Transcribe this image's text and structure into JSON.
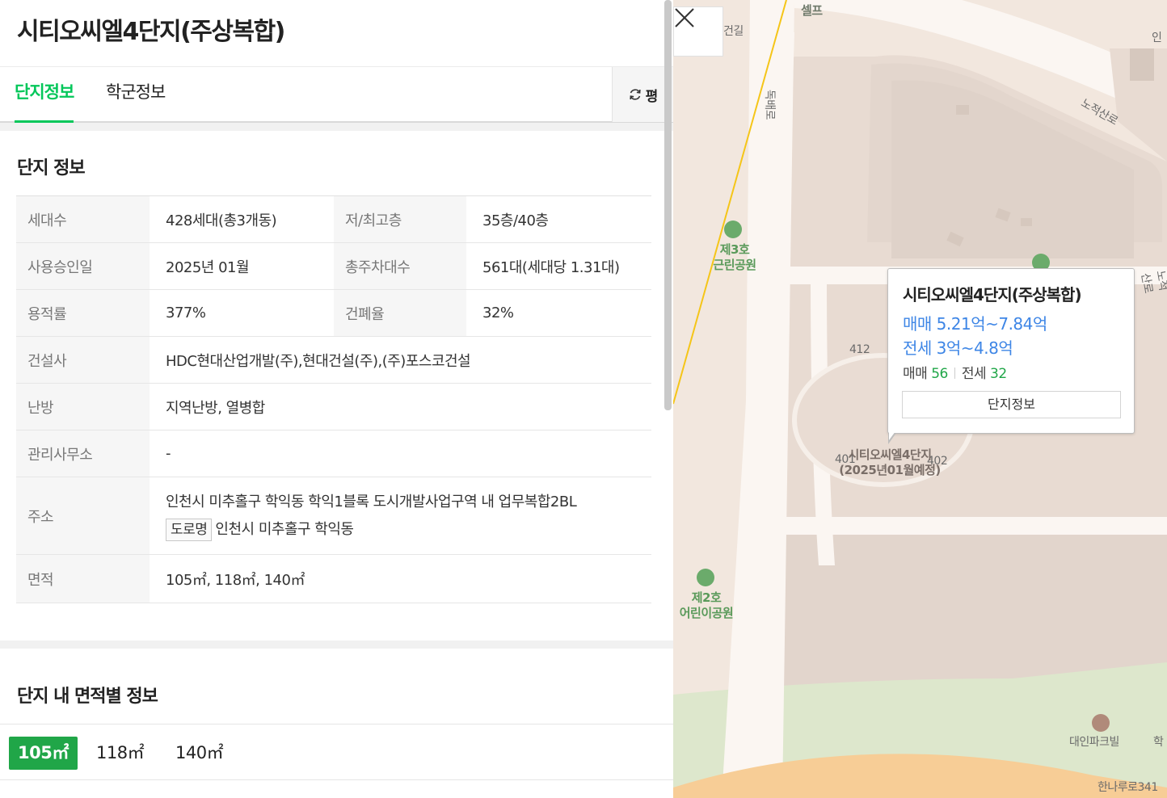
{
  "panel": {
    "title": "시티오씨엘4단지(주상복합)",
    "tabs": [
      "단지정보",
      "학군정보"
    ],
    "unit_toggle_label": "평"
  },
  "info": {
    "heading": "단지 정보",
    "rows": {
      "households_label": "세대수",
      "households_value": "428세대(총3개동)",
      "floors_label": "저/최고층",
      "floors_value": "35층/40층",
      "approval_label": "사용승인일",
      "approval_value": "2025년 01월",
      "parking_label": "총주차대수",
      "parking_value": "561대(세대당 1.31대)",
      "far_label": "용적률",
      "far_value": "377%",
      "bcr_label": "건폐율",
      "bcr_value": "32%",
      "builder_label": "건설사",
      "builder_value": "HDC현대산업개발(주),현대건설(주),(주)포스코건설",
      "heating_label": "난방",
      "heating_value": "지역난방, 열병합",
      "office_label": "관리사무소",
      "office_value": "-",
      "address_label": "주소",
      "address_value": "인천시 미추홀구 학익동 학익1블록 도시개발사업구역 내 업무복합2BL",
      "road_badge": "도로명",
      "road_address": "인천시 미추홀구 학익동",
      "area_label": "면적",
      "area_value": "105㎡, 118㎡, 140㎡"
    }
  },
  "area_section": {
    "heading": "단지 내 면적별 정보",
    "tabs": [
      "105㎡",
      "118㎡",
      "140㎡"
    ]
  },
  "map": {
    "labels": {
      "top_poi": "셀프",
      "park3_line1": "제3호",
      "park3_line2": "근린공원",
      "park2_line1": "제2호",
      "park2_line2": "어린이공원",
      "road_nojeok": "노적산로",
      "road_dongbae": "독배로",
      "road_right": "노적산로",
      "complex_line1": "시티오씨엘4단지",
      "complex_line2": "(2025년01월예정)",
      "bldg_412a": "412",
      "bldg_401": "401",
      "bldg_402": "402",
      "daein": "대인파크빌",
      "hak": "학",
      "hanaru": "한나루로341",
      "gil": "건길",
      "in": "인"
    },
    "popup": {
      "title": "시티오씨엘4단지(주상복합)",
      "sale": "매매 5.21억~7.84억",
      "lease": "전세 3억~4.8억",
      "sale_count_label": "매매",
      "sale_count": "56",
      "lease_count_label": "전세",
      "lease_count": "32",
      "button": "단지정보"
    },
    "colors": {
      "background": "#f2e7de",
      "block": "#e8dbd2",
      "park": "#dde7cc",
      "road": "#fbf6f2",
      "rail": "#f5c518",
      "accent_green": "#03c75a",
      "price_blue": "#3e86e6"
    }
  }
}
